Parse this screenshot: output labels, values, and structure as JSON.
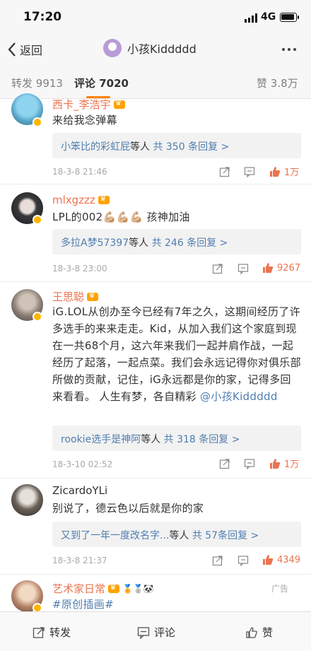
{
  "status": {
    "time": "17:20",
    "network": "4G"
  },
  "nav": {
    "back_label": "返回",
    "title": "小孩Kiddddd"
  },
  "tabs": [
    {
      "label": "转发",
      "count": "9913"
    },
    {
      "label": "评论",
      "count": "7020"
    },
    {
      "label": "赞",
      "count": "3.8万"
    }
  ],
  "comments": [
    {
      "name": "西卡_李浩宇",
      "text": "来给我念弹幕",
      "reply_from": "小笨比的彩虹屁",
      "reply_mid": "等人",
      "reply_count": "共 350 条回复 >",
      "time": "18-3-8 21:46",
      "likes": "1万"
    },
    {
      "name": "mlxgzzz",
      "text": "LPL的002💪🏼💪🏼💪🏼 孩神加油",
      "reply_from": "多拉A梦57397",
      "reply_mid": "等人",
      "reply_count": "共 246 条回复 >",
      "time": "18-3-8 23:00",
      "likes": "9267"
    },
    {
      "name": "王思聪",
      "text": "iG.LOL从创办至今已经有7年之久，这期间经历了许多选手的来来走走。Kid，从加入我们这个家庭到现在一共68个月，这六年来我们一起并肩作战，一起经历了起落，一起点菜。我们会永远记得你对俱乐部所做的贡献，记住，iG永远都是你的家，记得多回来看看。 人生有梦，各自精彩 ",
      "mention": "@小孩Kiddddd",
      "reply_from": "rookie选手是神阿",
      "reply_mid": "等人",
      "reply_count": "共 318 条回复 >",
      "time": "18-3-10 02:52",
      "likes": "1万"
    },
    {
      "name": "ZicardoYLi",
      "text": "别说了，德云色以后就是你的家",
      "reply_from": "又到了一年一度改名字...",
      "reply_mid": "等人",
      "reply_count": "共 57条回复 >",
      "time": "18-3-8 21:37",
      "likes": "4349"
    }
  ],
  "ad": {
    "name": "艺术家日常",
    "badges": "🏅🥈🐼",
    "label": "广告",
    "text": "#原创插画#"
  },
  "bottom": {
    "repost": "转发",
    "comment": "评论",
    "like": "赞"
  },
  "colors": {
    "accent": "#ff8200",
    "name": "#eb7350",
    "link": "#507daf"
  }
}
